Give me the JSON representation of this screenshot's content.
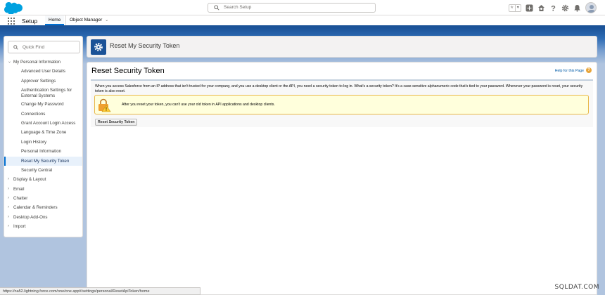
{
  "header": {
    "search_placeholder": "Search Setup",
    "favorites_star": "★",
    "favorites_chevron": "▾"
  },
  "nav": {
    "app_name": "Setup",
    "tabs": [
      {
        "label": "Home"
      },
      {
        "label": "Object Manager"
      }
    ],
    "object_manager_chevron": "⌄"
  },
  "sidebar": {
    "quick_find_placeholder": "Quick Find",
    "items": [
      {
        "label": "My Personal Information",
        "caret": "⌄"
      },
      {
        "label": "Advanced User Details"
      },
      {
        "label": "Approver Settings"
      },
      {
        "label": "Authentication Settings for External Systems"
      },
      {
        "label": "Change My Password"
      },
      {
        "label": "Connections"
      },
      {
        "label": "Grant Account Login Access"
      },
      {
        "label": "Language & Time Zone"
      },
      {
        "label": "Login History"
      },
      {
        "label": "Personal Information"
      },
      {
        "label": "Reset My Security Token"
      },
      {
        "label": "Security Central"
      },
      {
        "label": "Display & Layout",
        "caret": "›"
      },
      {
        "label": "Email",
        "caret": "›"
      },
      {
        "label": "Chatter",
        "caret": "›"
      },
      {
        "label": "Calendar & Reminders",
        "caret": "›"
      },
      {
        "label": "Desktop Add-Ons",
        "caret": "›"
      },
      {
        "label": "Import",
        "caret": "›"
      }
    ]
  },
  "banner": {
    "title": "Reset My Security Token"
  },
  "main": {
    "title": "Reset Security Token",
    "help_link": "Help for this Page",
    "help_icon": "?",
    "intro": "When you access Salesforce from an IP address that isn't trusted for your company, and you use a desktop client or the API, you need a security token to log in. What's a security token? It's a case-sensitive alphanumeric code that's tied to your password. Whenever your password is reset, your security token is also reset.",
    "warning": "After you reset your token, you can't use your old token in API applications and desktop clients.",
    "button_label": "Reset Security Token"
  },
  "statusbar": {
    "url": "https://na52.lightning.force.com/one/one.app#/settings/personal/ResetApiToken/home"
  },
  "watermark": "SQLDAT.COM",
  "colors": {
    "brand_blue": "#1b5297",
    "link": "#015ba7",
    "active_nav_bg": "#e8f1fb",
    "warning_bg": "#ffffdc",
    "warning_border": "#e8b84a"
  }
}
